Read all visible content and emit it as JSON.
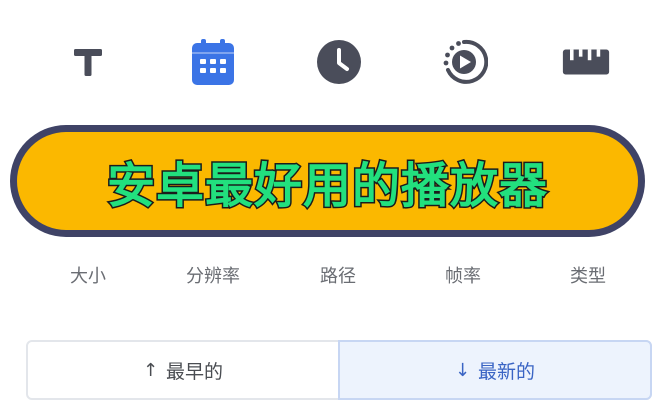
{
  "banner": {
    "text": "安卓最好用的播放器"
  },
  "sort_icons": [
    {
      "icon": "text-icon"
    },
    {
      "icon": "calendar-icon",
      "color": "#3b74e6"
    },
    {
      "icon": "clock-icon"
    },
    {
      "icon": "playback-rate-icon"
    },
    {
      "icon": "ruler-icon"
    }
  ],
  "sort_labels": [
    "大小",
    "分辨率",
    "路径",
    "帧率",
    "类型"
  ],
  "order": {
    "oldest_label": "最早的",
    "newest_label": "最新的",
    "selected": "newest"
  },
  "colors": {
    "icon_dark": "#4a4d5a",
    "accent_blue": "#3b74e6",
    "banner_fill": "#fbb800",
    "banner_border": "#3f4366",
    "banner_text": "#22e07e"
  }
}
